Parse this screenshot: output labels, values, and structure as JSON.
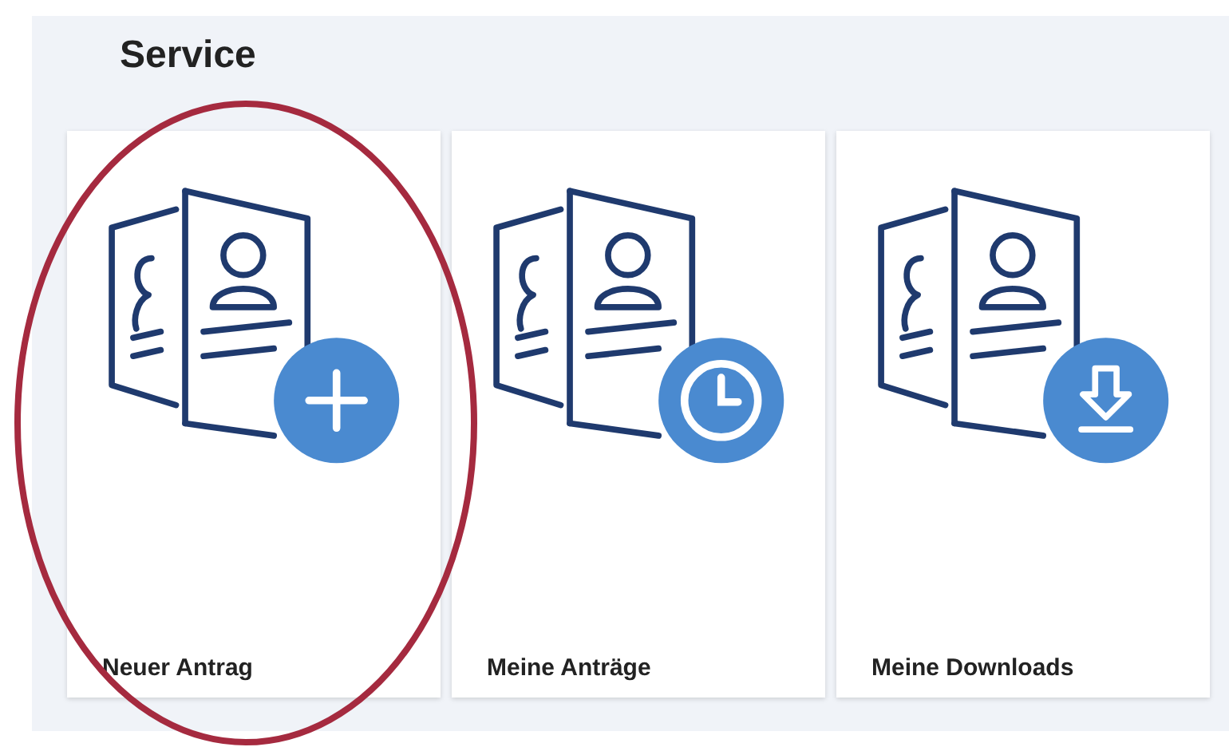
{
  "section": {
    "title": "Service"
  },
  "cards": [
    {
      "label": "Neuer Antrag",
      "kind": "add",
      "highlighted": true
    },
    {
      "label": "Meine Anträge",
      "kind": "history",
      "highlighted": false
    },
    {
      "label": "Meine Downloads",
      "kind": "download",
      "highlighted": false
    }
  ]
}
